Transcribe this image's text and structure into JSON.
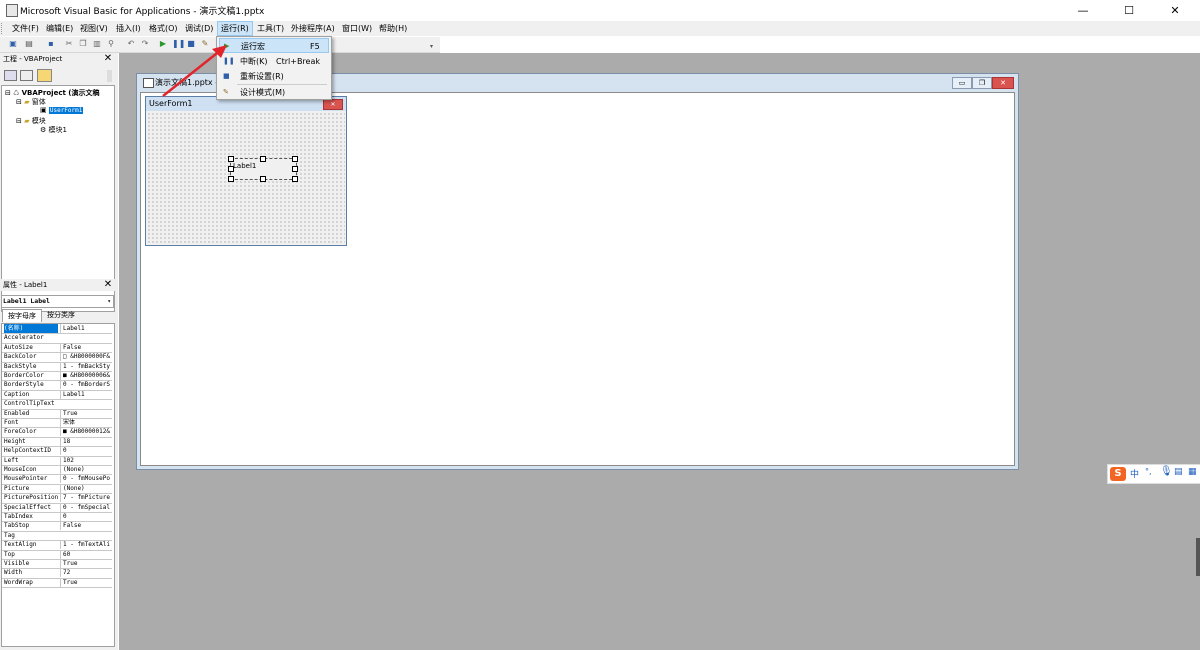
{
  "window": {
    "title": "Microsoft Visual Basic for Applications - 演示文稿1.pptx",
    "minimize": "—",
    "maximize": "☐",
    "close": "✕"
  },
  "menu": [
    "文件(F)",
    "编辑(E)",
    "视图(V)",
    "插入(I)",
    "格式(O)",
    "调试(D)",
    "运行(R)",
    "工具(T)",
    "外接程序(A)",
    "窗口(W)",
    "帮助(H)"
  ],
  "run_menu": {
    "items": [
      {
        "label": "运行宏",
        "shortcut": "F5",
        "icon": "play-icon",
        "highlighted": true
      },
      {
        "label": "中断(K)",
        "shortcut": "Ctrl+Break",
        "icon": "pause-icon",
        "highlighted": false
      },
      {
        "label": "重新设置(R)",
        "shortcut": "",
        "icon": "stop-icon",
        "highlighted": false
      },
      {
        "label": "设计模式(M)",
        "shortcut": "",
        "icon": "design-mode-icon",
        "highlighted": false
      }
    ]
  },
  "project": {
    "header": "工程 - VBAProject",
    "root": "VBAProject (演示文稿",
    "forms_folder": "窗体",
    "form": "UserForm1",
    "modules_folder": "模块",
    "module": "模块1"
  },
  "properties": {
    "header": "属性 - Label1",
    "object": "Label1 Label",
    "tabs": [
      "按字母序",
      "按分类序"
    ],
    "rows": [
      [
        "(名称)",
        "Label1"
      ],
      [
        "Accelerator",
        ""
      ],
      [
        "AutoSize",
        "False"
      ],
      [
        "BackColor",
        "□ &H8000000F&"
      ],
      [
        "BackStyle",
        "1 - fmBackSty"
      ],
      [
        "BorderColor",
        "■ &H80000006&"
      ],
      [
        "BorderStyle",
        "0 - fmBorderS"
      ],
      [
        "Caption",
        "Label1"
      ],
      [
        "ControlTipText",
        ""
      ],
      [
        "Enabled",
        "True"
      ],
      [
        "Font",
        "宋体"
      ],
      [
        "ForeColor",
        "■ &H80000012&"
      ],
      [
        "Height",
        "18"
      ],
      [
        "HelpContextID",
        "0"
      ],
      [
        "Left",
        "102"
      ],
      [
        "MouseIcon",
        "(None)"
      ],
      [
        "MousePointer",
        "0 - fmMousePo"
      ],
      [
        "Picture",
        "(None)"
      ],
      [
        "PicturePosition",
        "7 - fmPicture"
      ],
      [
        "SpecialEffect",
        "0 - fmSpecial"
      ],
      [
        "TabIndex",
        "0"
      ],
      [
        "TabStop",
        "False"
      ],
      [
        "Tag",
        ""
      ],
      [
        "TextAlign",
        "1 - fmTextAli"
      ],
      [
        "Top",
        "60"
      ],
      [
        "Visible",
        "True"
      ],
      [
        "Width",
        "72"
      ],
      [
        "WordWrap",
        "True"
      ]
    ]
  },
  "document_window": {
    "title": "演示文稿1.pptx -"
  },
  "userform": {
    "caption": "UserForm1",
    "label": "Label1"
  },
  "ime": {
    "chars": "中"
  },
  "colors": {
    "accent_arrow": "#e0262c",
    "selection": "#0078d7",
    "menu_highlight": "#cce4f7"
  }
}
